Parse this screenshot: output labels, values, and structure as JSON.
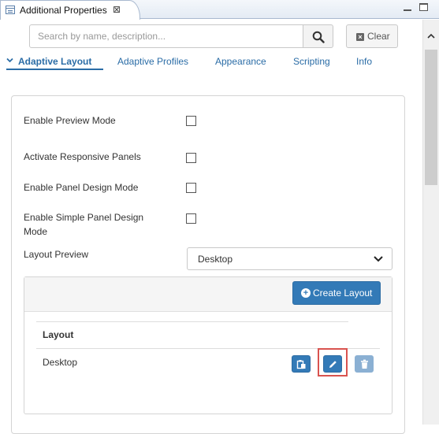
{
  "view": {
    "title": "Additional Properties",
    "close_symbol": "⊠"
  },
  "search": {
    "placeholder": "Search by name, description...",
    "value": "",
    "clear_label": "Clear"
  },
  "tabs": [
    {
      "label": "Adaptive Layout",
      "active": true
    },
    {
      "label": "Adaptive Profiles",
      "active": false
    },
    {
      "label": "Appearance",
      "active": false
    },
    {
      "label": "Scripting",
      "active": false
    },
    {
      "label": "Info",
      "active": false
    }
  ],
  "properties": [
    {
      "label": "Enable Preview Mode",
      "checked": false
    },
    {
      "label": "Activate Responsive Panels",
      "checked": false
    },
    {
      "label": "Enable Panel Design Mode",
      "checked": false
    },
    {
      "label": "Enable Simple Panel Design Mode",
      "checked": false
    }
  ],
  "layout_preview": {
    "label": "Layout Preview",
    "value": "Desktop"
  },
  "layouts": {
    "create_label": "Create Layout",
    "column_header": "Layout",
    "rows": [
      {
        "name": "Desktop"
      }
    ]
  },
  "colors": {
    "accent": "#337ab7",
    "tab_text": "#2a6ca6",
    "highlight": "#d9534f"
  }
}
